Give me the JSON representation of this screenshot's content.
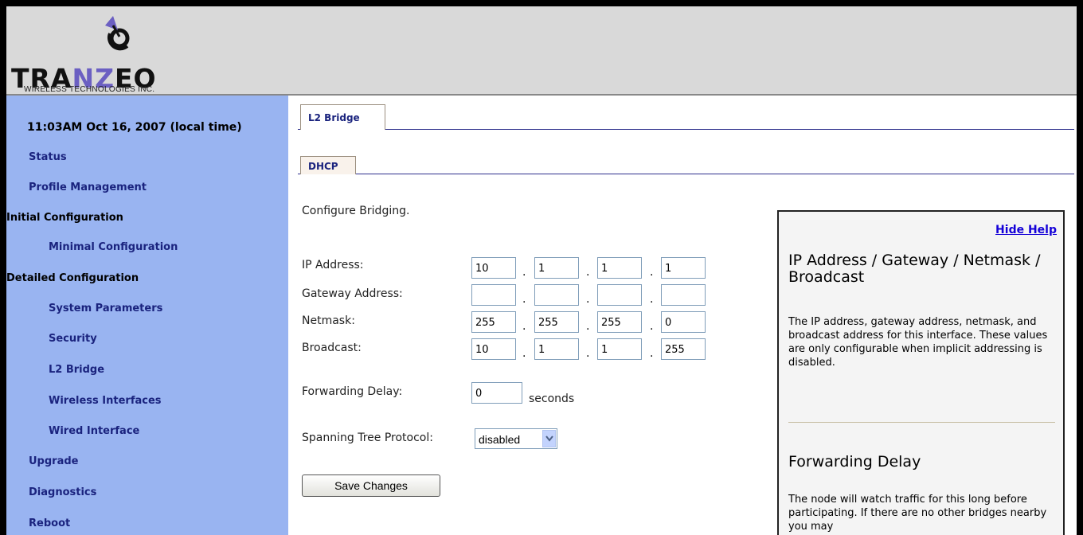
{
  "brand": {
    "name_pre": "TRA",
    "name_mid": "NZ",
    "name_post": "EO",
    "tagline": "WIRELESS TECHNOLOGIES INC."
  },
  "sidebar": {
    "time": "11:03AM Oct 16, 2007 (local time)",
    "items": [
      {
        "label": "Status"
      },
      {
        "label": "Profile Management"
      },
      {
        "label": "Initial Configuration"
      },
      {
        "label": "Minimal Configuration"
      },
      {
        "label": "Detailed Configuration"
      },
      {
        "label": "System Parameters"
      },
      {
        "label": "Security"
      },
      {
        "label": "L2 Bridge"
      },
      {
        "label": "Wireless Interfaces"
      },
      {
        "label": "Wired Interface"
      },
      {
        "label": "Upgrade"
      },
      {
        "label": "Diagnostics"
      },
      {
        "label": "Reboot"
      }
    ]
  },
  "tabs": {
    "primary": "L2 Bridge",
    "secondary": "DHCP"
  },
  "form": {
    "intro": "Configure Bridging.",
    "ip_label": "IP Address:",
    "gateway_label": "Gateway Address:",
    "netmask_label": "Netmask:",
    "broadcast_label": "Broadcast:",
    "ip": [
      "10",
      "1",
      "1",
      "1"
    ],
    "gateway": [
      "",
      "",
      "",
      ""
    ],
    "netmask": [
      "255",
      "255",
      "255",
      "0"
    ],
    "broadcast": [
      "10",
      "1",
      "1",
      "255"
    ],
    "dot": ".",
    "fwd_label": "Forwarding Delay:",
    "fwd_value": "0",
    "fwd_unit": "seconds",
    "stp_label": "Spanning Tree Protocol:",
    "stp_value": "disabled",
    "save_label": "Save Changes"
  },
  "help": {
    "hide_label": "Hide Help",
    "h1": "IP Address / Gateway / Netmask / Broadcast",
    "p1": "The IP address, gateway address, netmask, and broadcast address for this interface. These values are only configurable when implicit addressing is disabled.",
    "h2": "Forwarding Delay",
    "p2": "The node will watch traffic for this long before participating. If there are no other bridges nearby you may"
  }
}
